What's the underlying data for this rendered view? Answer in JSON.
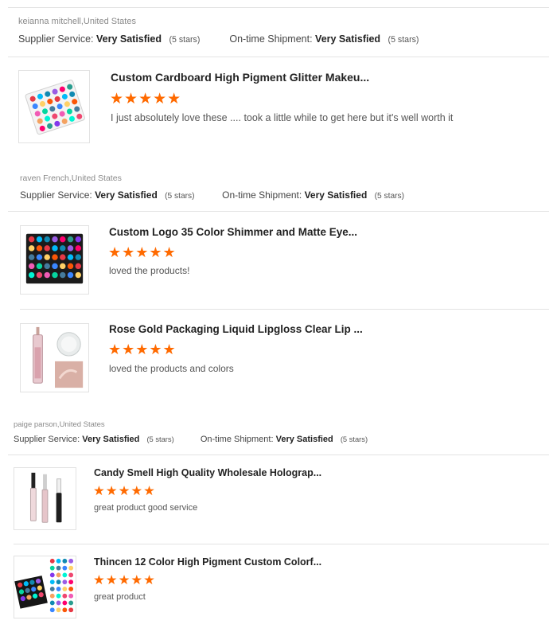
{
  "reviews": [
    {
      "reviewer": "keianna mitchell,United States",
      "supplier_label": "Supplier Service:",
      "supplier_value": "Very Satisfied",
      "supplier_stars": "(5 stars)",
      "shipment_label": "On-time Shipment:",
      "shipment_value": "Very Satisfied",
      "shipment_stars": "(5 stars)",
      "products": [
        {
          "title": "Custom Cardboard High Pigment Glitter Makeu...",
          "rating": 5,
          "stars": "★★★★★",
          "comment": "I just absolutely love these .... took a little while to get here but it's well worth it",
          "image": "white-eyeshadow-palette-image"
        }
      ]
    },
    {
      "reviewer": "raven French,United States",
      "supplier_label": "Supplier Service:",
      "supplier_value": "Very Satisfied",
      "supplier_stars": "(5 stars)",
      "shipment_label": "On-time Shipment:",
      "shipment_value": "Very Satisfied",
      "shipment_stars": "(5 stars)",
      "products": [
        {
          "title": "Custom Logo 35 Color Shimmer and Matte Eye...",
          "rating": 5,
          "stars": "★★★★★",
          "comment": "loved the products!",
          "image": "black-eyeshadow-palette-image"
        },
        {
          "title": "Rose Gold Packaging Liquid Lipgloss Clear Lip ...",
          "rating": 5,
          "stars": "★★★★★",
          "comment": "loved the products and colors",
          "image": "lipgloss-image"
        }
      ]
    },
    {
      "reviewer": "paige parson,United States",
      "supplier_label": "Supplier Service:",
      "supplier_value": "Very Satisfied",
      "supplier_stars": "(5 stars)",
      "shipment_label": "On-time Shipment:",
      "shipment_value": "Very Satisfied",
      "shipment_stars": "(5 stars)",
      "products": [
        {
          "title": "Candy Smell High Quality Wholesale Holograp...",
          "rating": 5,
          "stars": "★★★★★",
          "comment": "great product good service",
          "image": "lip-tubes-image"
        },
        {
          "title": "Thincen 12 Color High Pigment Custom Colorf...",
          "rating": 5,
          "stars": "★★★★★",
          "comment": "great product",
          "image": "palette-collage-image"
        }
      ]
    }
  ],
  "colors": {
    "star": "#ff6a00",
    "divider": "#e3e3e3"
  }
}
